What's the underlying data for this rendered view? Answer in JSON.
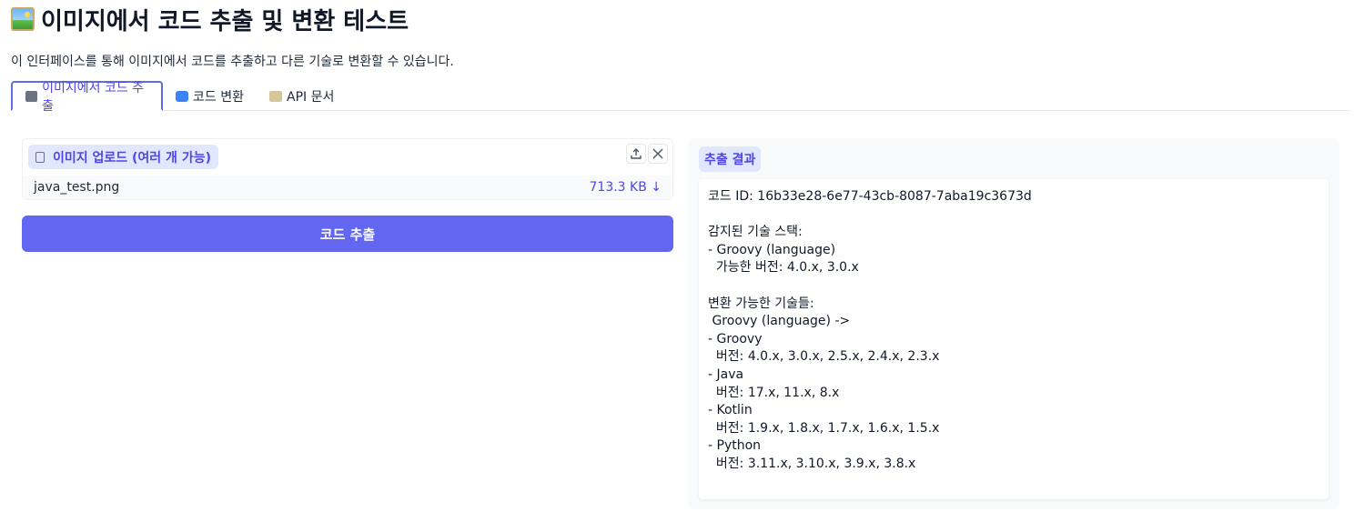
{
  "page": {
    "title": "이미지에서 코드 추출 및 변환 테스트",
    "subtitle": "이 인터페이스를 통해 이미지에서 코드를 추출하고 다른 기술로 변환할 수 있습니다."
  },
  "tabs": [
    {
      "label": "이미지에서 코드 추출",
      "icon": "camera-icon",
      "active": true
    },
    {
      "label": "코드 변환",
      "icon": "refresh-icon",
      "active": false
    },
    {
      "label": "API 문서",
      "icon": "notepad-icon",
      "active": false
    }
  ],
  "upload": {
    "label": "이미지 업로드 (여러 개 가능)",
    "file_name": "java_test.png",
    "file_size": "713.3 KB ↓"
  },
  "extract_button": "코드 추출",
  "result": {
    "label": "추출 결과",
    "text": "코드 ID: 16b33e28-6e77-43cb-8087-7aba19c3673d\n\n감지된 기술 스택:\n- Groovy (language)\n  가능한 버전: 4.0.x, 3.0.x\n\n변환 가능한 기술들:\n Groovy (language) ->\n- Groovy\n  버전: 4.0.x, 3.0.x, 2.5.x, 2.4.x, 2.3.x\n- Java\n  버전: 17.x, 11.x, 8.x\n- Kotlin\n  버전: 1.9.x, 1.8.x, 1.7.x, 1.6.x, 1.5.x\n- Python\n  버전: 3.11.x, 3.10.x, 3.9.x, 3.8.x"
  },
  "colors": {
    "accent": "#6366f1",
    "label_bg": "#e0e7ff",
    "label_text": "#4f46e5"
  }
}
